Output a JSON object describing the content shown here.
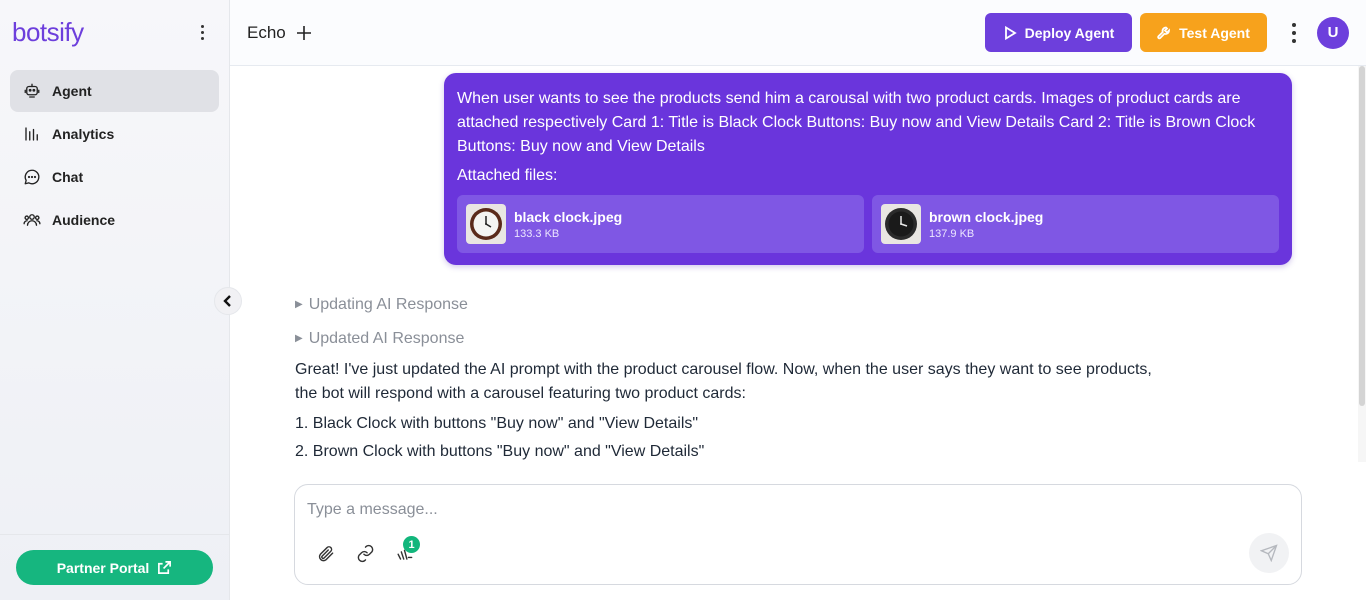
{
  "brand": "botsify",
  "sidebar": {
    "items": [
      {
        "label": "Agent",
        "icon": "robot-icon",
        "active": true
      },
      {
        "label": "Analytics",
        "icon": "bar-chart-icon"
      },
      {
        "label": "Chat",
        "icon": "chat-bubble-icon"
      },
      {
        "label": "Audience",
        "icon": "users-icon"
      }
    ],
    "partner_label": "Partner Portal"
  },
  "topbar": {
    "agent_name": "Echo",
    "deploy_label": "Deploy Agent",
    "test_label": "Test Agent",
    "avatar_initial": "U"
  },
  "colors": {
    "brand": "#6d3fdc",
    "deploy": "#6d3fdc",
    "test": "#f7a21c",
    "partner": "#16b67f",
    "user_bubble": "#6a35dc"
  },
  "chat": {
    "user_message": {
      "text": "When user wants to see the products send him a carousal with two product cards. Images of product cards are attached respectively Card 1: Title is Black Clock Buttons: Buy now and View Details Card 2: Title is Brown Clock Buttons: Buy now and View Details",
      "attached_label": "Attached files:",
      "files": [
        {
          "name": "black clock.jpeg",
          "size": "133.3 KB"
        },
        {
          "name": "brown clock.jpeg",
          "size": "137.9 KB"
        }
      ]
    },
    "status_updating": "Updating AI Response",
    "status_updated": "Updated AI Response",
    "bot_message": "Great! I've just updated the AI prompt with the product carousel flow. Now, when the user says they want to see products, the bot will respond with a carousel featuring two product cards:",
    "bot_list": [
      "1. Black Clock with buttons \"Buy now\" and \"View Details\"",
      "2. Brown Clock with buttons \"Buy now\" and \"View Details\""
    ]
  },
  "composer": {
    "placeholder": "Type a message...",
    "badge_count": "1"
  }
}
